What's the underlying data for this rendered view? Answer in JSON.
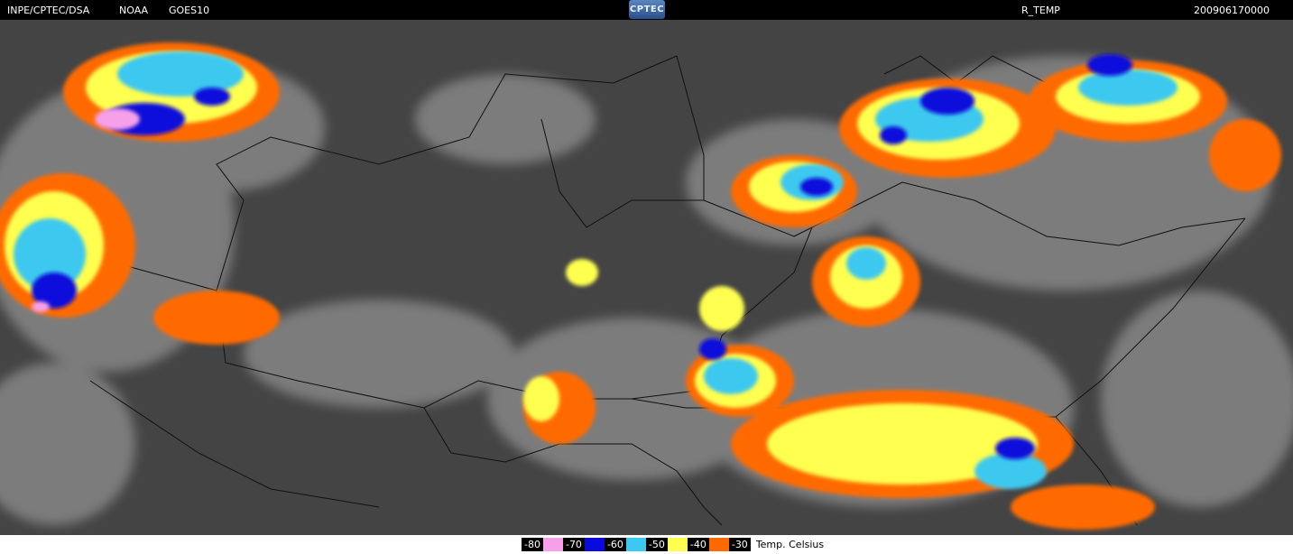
{
  "header": {
    "agency": "INPE/CPTEC/DSA",
    "source": "NOAA",
    "satellite": "GOES10",
    "logo": "CPTEC",
    "product": "R_TEMP",
    "timestamp": "200906170000"
  },
  "legend": {
    "items": [
      {
        "label": "-80",
        "color": "#f5a0e8"
      },
      {
        "label": "-70",
        "color": "#0a0adc"
      },
      {
        "label": "-60",
        "color": "#3cc8f0"
      },
      {
        "label": "-50",
        "color": "#ffff50"
      },
      {
        "label": "-40",
        "color": "#ff6a00"
      },
      {
        "label": "-30",
        "color": ""
      }
    ],
    "unit": "Temp. Celsius"
  },
  "colors": {
    "background_cloud_gray": "#4a4a4a",
    "borders": "#000000"
  }
}
